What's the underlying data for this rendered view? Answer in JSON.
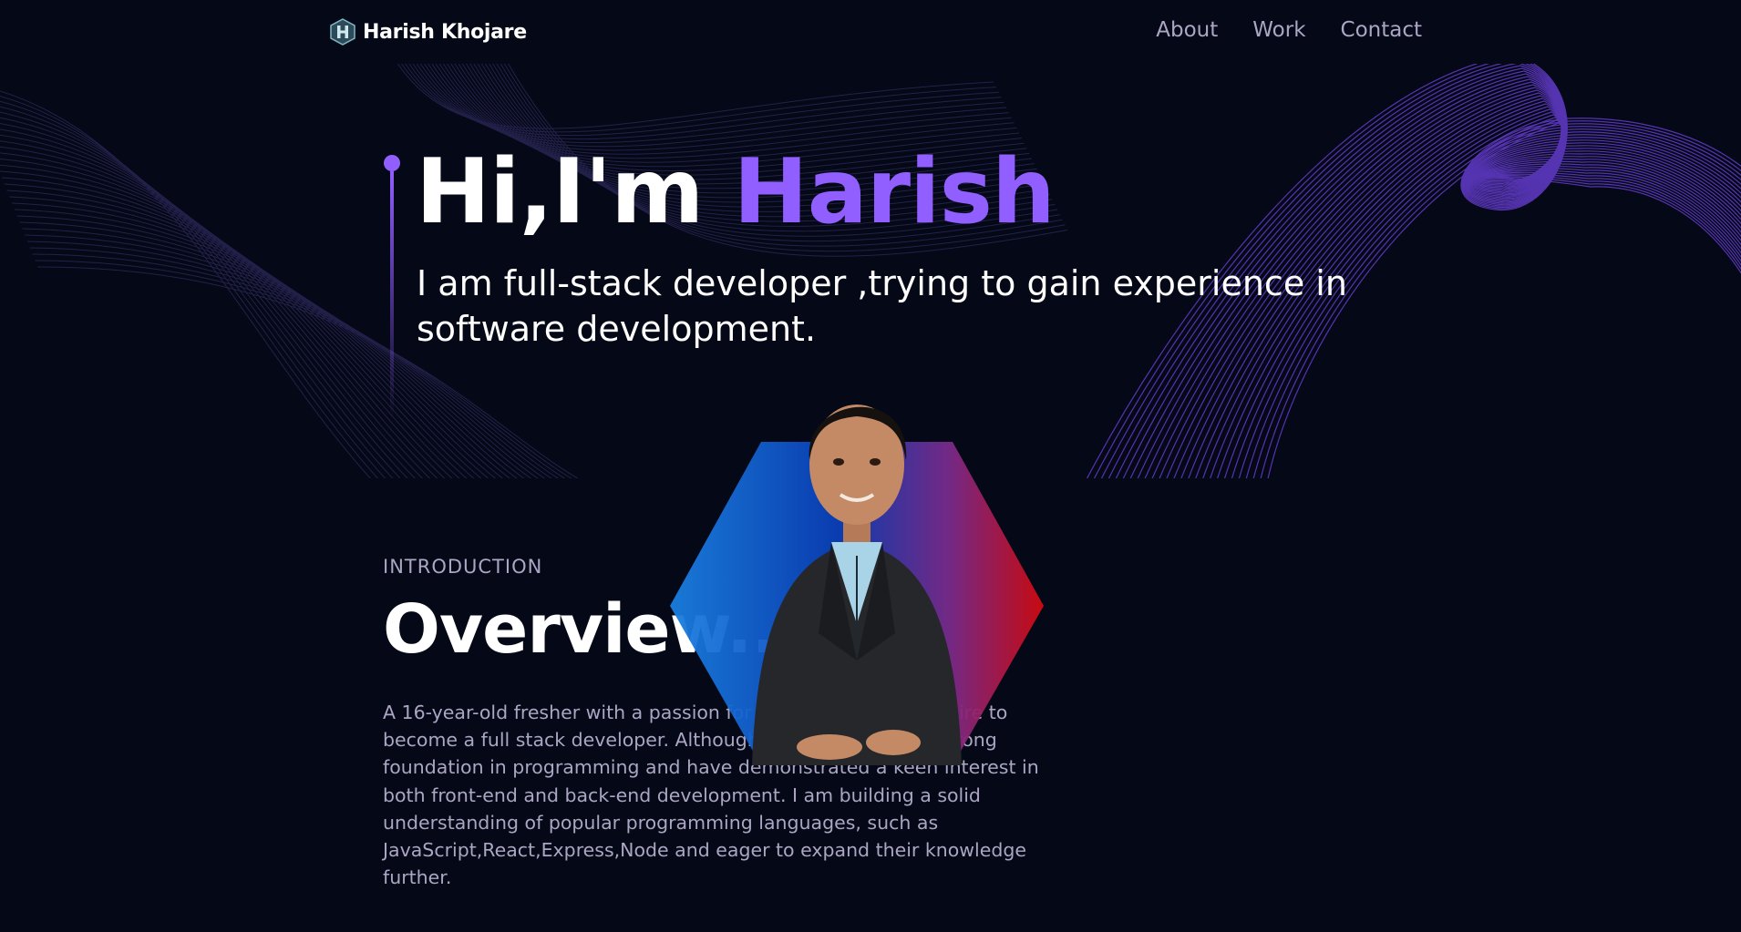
{
  "nav": {
    "brand_name": "Harish Khojare",
    "links": [
      {
        "label": "About"
      },
      {
        "label": "Work"
      },
      {
        "label": "Contact"
      }
    ]
  },
  "hero": {
    "title_prefix": "Hi,I'm ",
    "title_name": "Harish",
    "subtitle": "I am full-stack developer ,trying to gain experience in software development."
  },
  "about": {
    "label": "INTRODUCTION",
    "title": "Overview..",
    "text": "A 16-year-old fresher with a passion for technology and a desire to become a full stack developer. Although young,I possess a strong foundation in programming and have demonstrated a keen interest in both front-end and back-end development. I am building a solid understanding of popular programming languages, such as JavaScript,React,Express,Node and eager to expand their knowledge further."
  },
  "colors": {
    "background": "#050816",
    "accent": "#915eff",
    "secondary_text": "#aaa6c3"
  },
  "icons": [
    "logo-hex-icon",
    "portrait-photo"
  ]
}
